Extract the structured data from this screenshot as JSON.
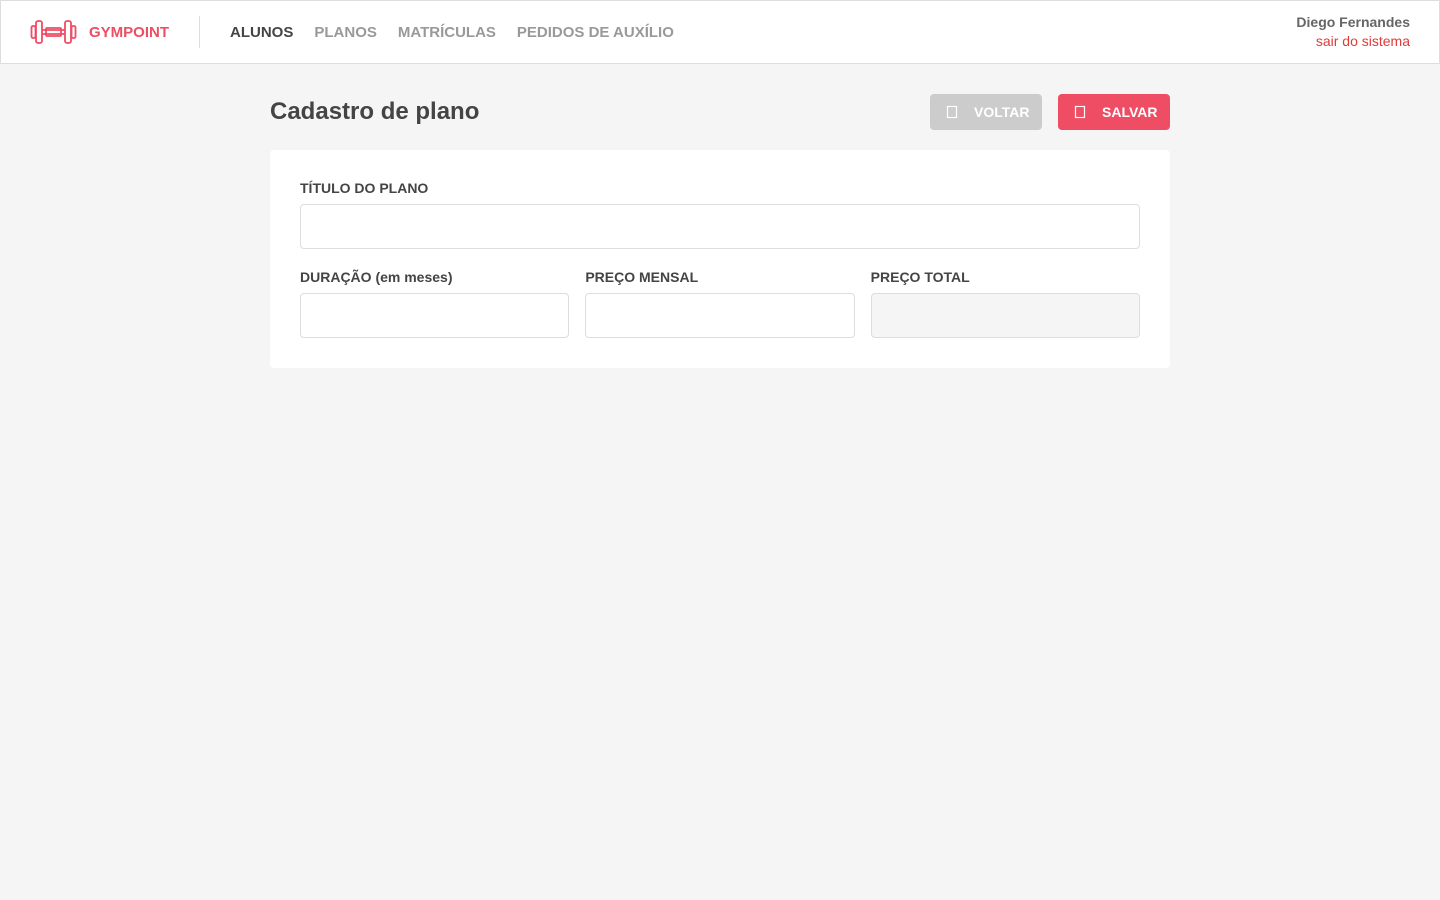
{
  "header": {
    "brand": "GYMPOINT",
    "brand_icon": "dumbbell-icon",
    "accent_color": "#ee4d64",
    "nav": [
      {
        "label": "ALUNOS",
        "active": true
      },
      {
        "label": "PLANOS",
        "active": false
      },
      {
        "label": "MATRÍCULAS",
        "active": false
      },
      {
        "label": "PEDIDOS DE AUXÍLIO",
        "active": false
      }
    ],
    "user_name": "Diego Fernandes",
    "logout_label": "sair do sistema"
  },
  "page": {
    "title": "Cadastro de plano",
    "back_label": "VOLTAR",
    "back_icon": "chevron-left-icon",
    "save_label": "SALVAR",
    "save_icon": "check-icon"
  },
  "form": {
    "title_label": "TÍTULO DO PLANO",
    "title_value": "",
    "duration_label": "DURAÇÃO (em meses)",
    "duration_value": "",
    "monthly_price_label": "PREÇO MENSAL",
    "monthly_price_value": "",
    "total_price_label": "PREÇO TOTAL",
    "total_price_value": ""
  }
}
